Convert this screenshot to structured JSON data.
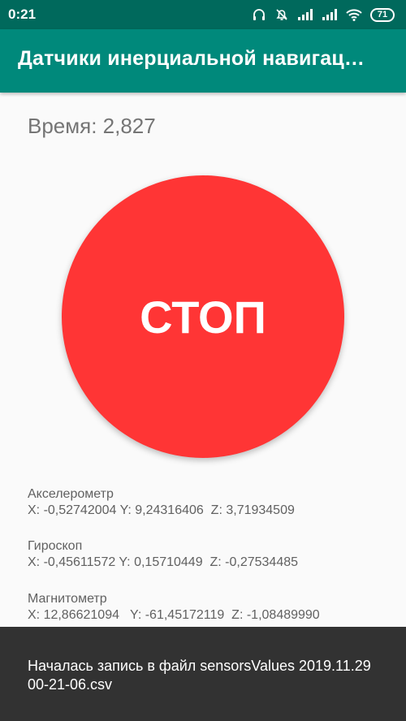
{
  "status_bar": {
    "time": "0:21",
    "battery": "71",
    "icons": [
      "headphones-icon",
      "bell-off-icon",
      "signal-icon",
      "signal-icon",
      "wifi-icon",
      "battery-icon"
    ]
  },
  "app_bar": {
    "title": "Датчики инерциальной навигац…"
  },
  "timer": {
    "text": "Время: 2,827"
  },
  "stop_button": {
    "label": "СТОП",
    "color": "#ff3535"
  },
  "sensors": [
    {
      "name": "Акселерометр",
      "values": "X: -0,52742004 Y: 9,24316406  Z: 3,71934509"
    },
    {
      "name": "Гироскоп",
      "values": "X: -0,45611572 Y: 0,15710449  Z: -0,27534485"
    },
    {
      "name": "Магнитометр",
      "values": "X: 12,86621094   Y: -61,45172119  Z: -1,08489990"
    }
  ],
  "snackbar": {
    "message": "Началась запись в файл sensorsValues 2019.11.29 00-21-06.csv"
  },
  "colors": {
    "status_bar": "#00695c",
    "app_bar": "#00897b",
    "snackbar": "#323232"
  }
}
